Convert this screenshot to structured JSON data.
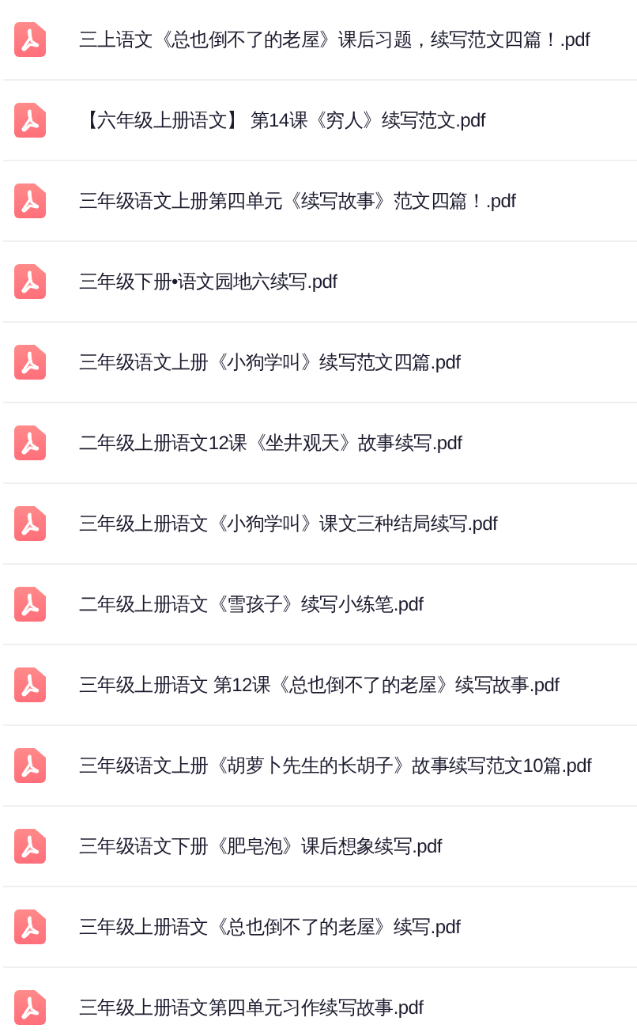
{
  "files": [
    {
      "name": "三上语文《总也倒不了的老屋》课后习题，续写范文四篇！.pdf",
      "kind": "pdf"
    },
    {
      "name": "【六年级上册语文】 第14课《穷人》续写范文.pdf",
      "kind": "pdf"
    },
    {
      "name": "三年级语文上册第四单元《续写故事》范文四篇！.pdf",
      "kind": "pdf"
    },
    {
      "name": "三年级下册•语文园地六续写.pdf",
      "kind": "pdf"
    },
    {
      "name": "三年级语文上册《小狗学叫》续写范文四篇.pdf",
      "kind": "pdf"
    },
    {
      "name": "二年级上册语文12课《坐井观天》故事续写.pdf",
      "kind": "pdf"
    },
    {
      "name": "三年级上册语文《小狗学叫》课文三种结局续写.pdf",
      "kind": "pdf"
    },
    {
      "name": "二年级上册语文《雪孩子》续写小练笔.pdf",
      "kind": "pdf"
    },
    {
      "name": "三年级上册语文 第12课《总也倒不了的老屋》续写故事.pdf",
      "kind": "pdf"
    },
    {
      "name": "三年级语文上册《胡萝卜先生的长胡子》故事续写范文10篇.pdf",
      "kind": "pdf"
    },
    {
      "name": "三年级语文下册《肥皂泡》课后想象续写.pdf",
      "kind": "pdf"
    },
    {
      "name": "三年级上册语文《总也倒不了的老屋》续写.pdf",
      "kind": "pdf"
    },
    {
      "name": "三年级上册语文第四单元习作续写故事.pdf",
      "kind": "pdf"
    }
  ]
}
